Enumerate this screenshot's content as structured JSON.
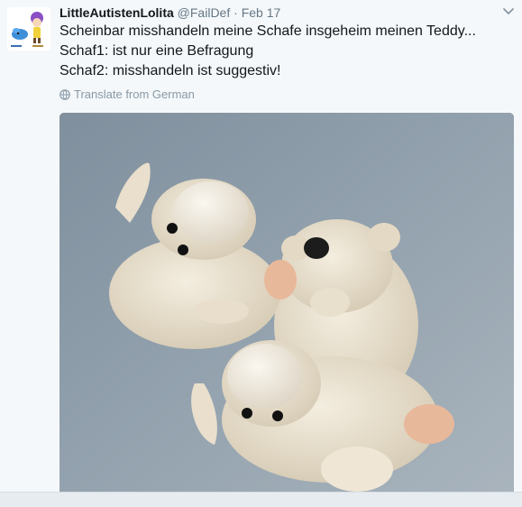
{
  "tweet": {
    "display_name": "LittleAutistenLolita",
    "handle": "@FailDef",
    "separator": "·",
    "date": "Feb 17",
    "lines": [
      "Scheinbar misshandeln meine Schafe insgeheim meinen Teddy...",
      "Schaf1: ist nur eine Befragung",
      "Schaf2: misshandeln ist suggestiv!"
    ],
    "translate_label": "Translate from German",
    "icons": {
      "more": "chevron-down-icon",
      "translate": "globe-icon",
      "avatar": "avatar-cartoon-characters"
    },
    "colors": {
      "text": "#14171a",
      "secondary": "#657786",
      "link": "#8899a6",
      "photo_background": "#8d9ba8"
    }
  }
}
